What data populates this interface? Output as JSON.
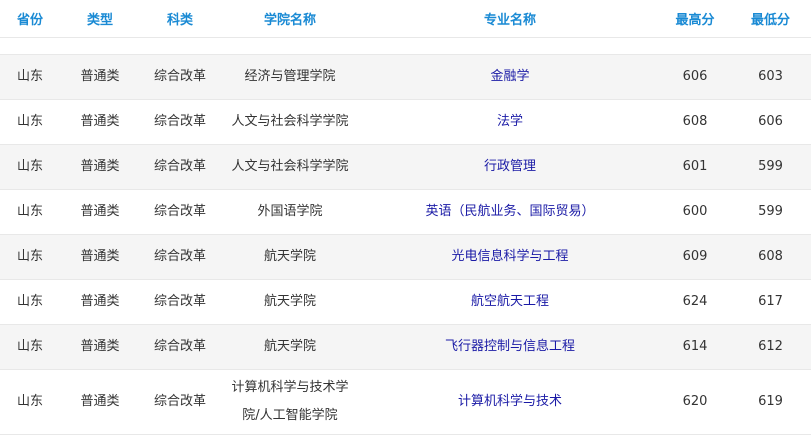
{
  "header_color": "#1a8ad4",
  "link_color": "#1a1aa6",
  "columns": [
    "省份",
    "类型",
    "科类",
    "学院名称",
    "专业名称",
    "最高分",
    "最低分"
  ],
  "rows": [
    {
      "province": "山东",
      "type": "普通类",
      "category": "综合改革",
      "college": "经济与管理学院",
      "major": "金融学",
      "max": "606",
      "min": "603"
    },
    {
      "province": "山东",
      "type": "普通类",
      "category": "综合改革",
      "college": "人文与社会科学学院",
      "major": "法学",
      "max": "608",
      "min": "606"
    },
    {
      "province": "山东",
      "type": "普通类",
      "category": "综合改革",
      "college": "人文与社会科学学院",
      "major": "行政管理",
      "max": "601",
      "min": "599"
    },
    {
      "province": "山东",
      "type": "普通类",
      "category": "综合改革",
      "college": "外国语学院",
      "major": "英语（民航业务、国际贸易）",
      "max": "600",
      "min": "599"
    },
    {
      "province": "山东",
      "type": "普通类",
      "category": "综合改革",
      "college": "航天学院",
      "major": "光电信息科学与工程",
      "max": "609",
      "min": "608"
    },
    {
      "province": "山东",
      "type": "普通类",
      "category": "综合改革",
      "college": "航天学院",
      "major": "航空航天工程",
      "max": "624",
      "min": "617"
    },
    {
      "province": "山东",
      "type": "普通类",
      "category": "综合改革",
      "college": "航天学院",
      "major": "飞行器控制与信息工程",
      "max": "614",
      "min": "612"
    },
    {
      "province": "山东",
      "type": "普通类",
      "category": "综合改革",
      "college_line1": "计算机科学与技术学",
      "college_line2": "院/人工智能学院",
      "major": "计算机科学与技术",
      "max": "620",
      "min": "619"
    }
  ]
}
